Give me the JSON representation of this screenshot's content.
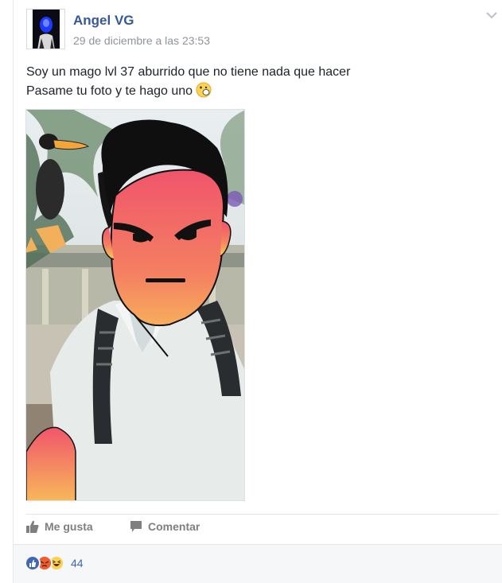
{
  "post": {
    "author": "Angel VG",
    "timestamp": "29 de diciembre a las 23:53",
    "text_line1": "Soy un mago lvl 37 aburrido que no tiene nada que hacer",
    "text_line2": "Pasame tu foto y te hago uno"
  },
  "actions": {
    "like_label": "Me gusta",
    "comment_label": "Comentar"
  },
  "reactions": {
    "icons": [
      "like-icon",
      "angry-icon",
      "haha-icon"
    ],
    "count": "44"
  },
  "colors": {
    "link": "#365899",
    "meta": "#90949c",
    "action": "#7f7f7f",
    "like_blue": "#4267b2",
    "face_top": "#f0556b",
    "face_bottom": "#f9c958"
  }
}
